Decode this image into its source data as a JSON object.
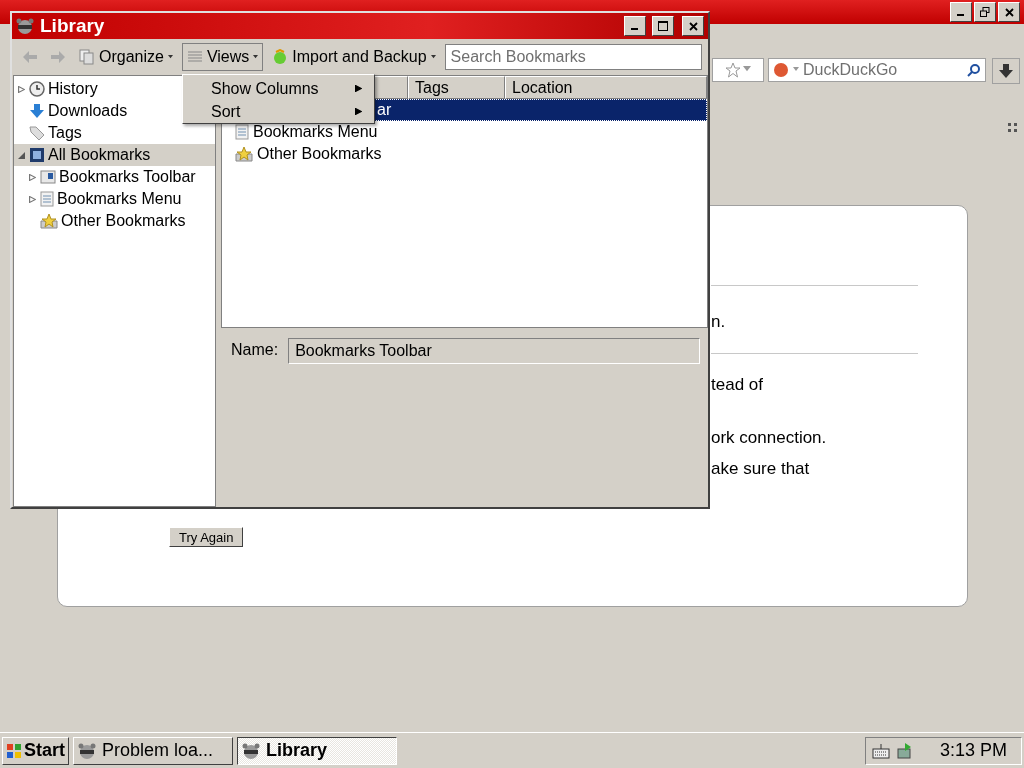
{
  "browser": {
    "search": {
      "placeholder": "DuckDuckGo"
    },
    "content": {
      "lines": [
        "n.",
        "tead of",
        "ork connection.",
        "ake sure that"
      ],
      "button": "Try Again"
    }
  },
  "library": {
    "title": "Library",
    "toolbar": {
      "buttons": [
        {
          "label": "Organize",
          "pressed": false
        },
        {
          "label": "Views",
          "pressed": true
        },
        {
          "label": "Import and Backup",
          "pressed": false
        }
      ],
      "search": {
        "placeholder": "Search Bookmarks"
      }
    },
    "sidebar": {
      "items": [
        {
          "label": "History",
          "kind": "history",
          "expanded": false,
          "selected": false
        },
        {
          "label": "Downloads",
          "kind": "downloads",
          "selected": false
        },
        {
          "label": "Tags",
          "kind": "tags",
          "selected": false
        },
        {
          "label": "All Bookmarks",
          "kind": "all",
          "expanded": true,
          "selected": true,
          "children": [
            {
              "label": "Bookmarks Toolbar",
              "kind": "toolbar",
              "expanded": false,
              "selected": false
            },
            {
              "label": "Bookmarks Menu",
              "kind": "menu",
              "expanded": false,
              "selected": false
            },
            {
              "label": "Other Bookmarks",
              "kind": "unfiled",
              "selected": false
            }
          ]
        }
      ]
    },
    "table": {
      "columns": [
        "Tags",
        "Location"
      ],
      "rows": [
        {
          "label": "ar",
          "kind": "covered",
          "selected": true
        },
        {
          "label": "Bookmarks Menu",
          "kind": "menu",
          "selected": false
        },
        {
          "label": "Other Bookmarks",
          "kind": "unfiled",
          "selected": false
        }
      ]
    },
    "details": {
      "name_label": "Name:",
      "name_value": "Bookmarks Toolbar"
    },
    "menu": {
      "items": [
        "Show Columns",
        "Sort"
      ]
    }
  },
  "taskbar": {
    "start": "Start",
    "tasks": [
      {
        "label": "Problem loa...",
        "selected": false
      },
      {
        "label": "Library",
        "selected": true
      }
    ],
    "clock": "3:13 PM"
  }
}
